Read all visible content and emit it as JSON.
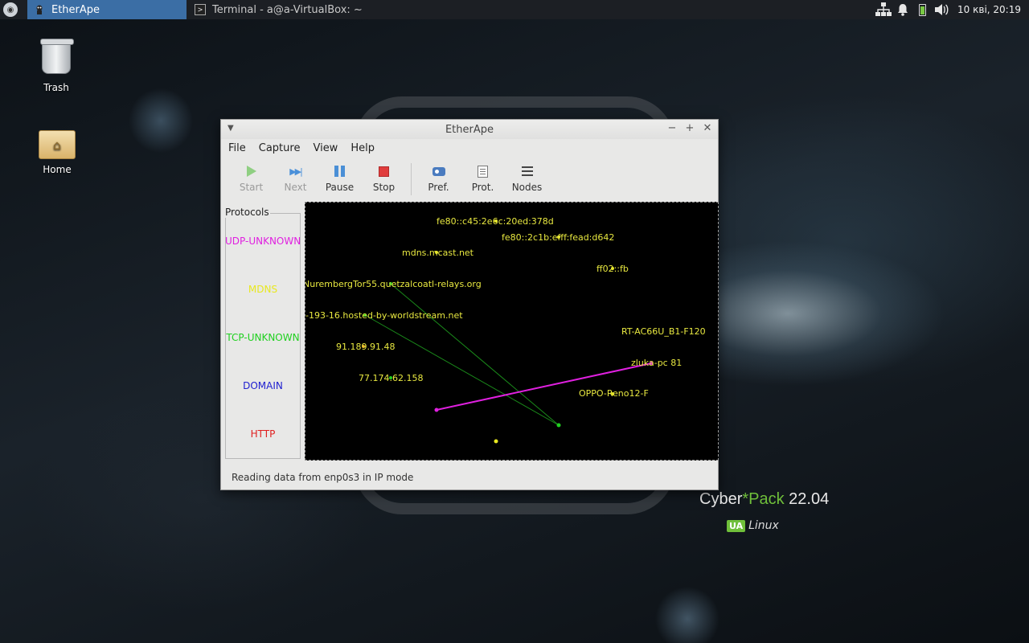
{
  "panel": {
    "tasks": [
      {
        "label": "EtherApe",
        "active": true
      },
      {
        "label": "Terminal - a@a-VirtualBox: ~",
        "active": false
      }
    ],
    "clock": "10 кві, 20:19"
  },
  "desktop": {
    "icons": [
      {
        "label": "Trash"
      },
      {
        "label": "Home"
      }
    ],
    "brand": {
      "prefix": "Cyber",
      "star": "*",
      "accent": "Pack",
      "version": " 22.04",
      "sub_badge": "UA",
      "sub_text": "Linux"
    }
  },
  "window": {
    "title": "EtherApe",
    "menu": [
      "File",
      "Capture",
      "View",
      "Help"
    ],
    "toolbar": {
      "start": "Start",
      "next": "Next",
      "pause": "Pause",
      "stop": "Stop",
      "pref": "Pref.",
      "prot": "Prot.",
      "nodes": "Nodes"
    },
    "protocols_title": "Protocols",
    "protocols": [
      {
        "name": "UDP-UNKNOWN",
        "color": "#e020e0"
      },
      {
        "name": "MDNS",
        "color": "#e8e820"
      },
      {
        "name": "TCP-UNKNOWN",
        "color": "#20d020"
      },
      {
        "name": "DOMAIN",
        "color": "#2020d0"
      },
      {
        "name": "HTTP",
        "color": "#e02020"
      }
    ],
    "nodes": [
      {
        "label": "fe80::c45:2e6c:20ed:378d"
      },
      {
        "label": "fe80::2c1b:efff:fead:d642"
      },
      {
        "label": "mdns.mcast.net"
      },
      {
        "label": "ff02::fb"
      },
      {
        "label": "NurembergTor55.quetzalcoatl-relays.org"
      },
      {
        "label": "-193-16.hosted-by-worldstream.net"
      },
      {
        "label": "RT-AC66U_B1-F120"
      },
      {
        "label": "91.189.91.48"
      },
      {
        "label": "zluka-pc 81"
      },
      {
        "label": "77.174.62.158"
      },
      {
        "label": "OPPO-Reno12-F"
      }
    ],
    "status": "Reading data from enp0s3 in IP mode"
  }
}
